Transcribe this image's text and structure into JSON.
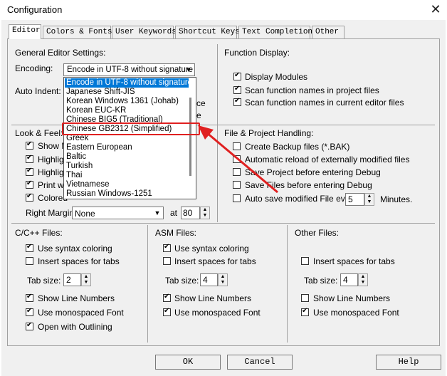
{
  "window": {
    "title": "Configuration",
    "close": "✕"
  },
  "tabs": [
    {
      "label": "Editor"
    },
    {
      "label": "Colors & Fonts"
    },
    {
      "label": "User Keywords"
    },
    {
      "label": "Shortcut Keys"
    },
    {
      "label": "Text Completion"
    },
    {
      "label": "Other"
    }
  ],
  "general": {
    "title": "General Editor Settings:",
    "encoding_label": "Encoding:",
    "encoding_value": "Encode in UTF-8 without signature",
    "auto_indent_label": "Auto Indent:",
    "partial_ce": "ce",
    "partial_e": "e"
  },
  "encoding_options": [
    "Encode in UTF-8 without signature",
    "Japanese Shift-JIS",
    "Korean Windows 1361 (Johab)",
    "Korean EUC-KR",
    "Chinese BIG5 (Traditional)",
    "Chinese GB2312 (Simplified)",
    "Greek",
    "Eastern European",
    "Baltic",
    "Turkish",
    "Thai",
    "Vietnamese",
    "Russian Windows-1251"
  ],
  "look_feel": {
    "title": "Look & Feel:",
    "items": [
      {
        "label": "Show M",
        "checked": true
      },
      {
        "label": "Highligh",
        "checked": true
      },
      {
        "label": "Highligh",
        "checked": true
      },
      {
        "label": "Print wit",
        "checked": true
      },
      {
        "label": "Colored",
        "checked": true
      }
    ],
    "right_margin_label": "Right Margin:",
    "right_margin_value": "None",
    "at_label": "at",
    "at_value": "80"
  },
  "function_display": {
    "title": "Function Display:",
    "items": [
      {
        "label": "Display Modules",
        "checked": true
      },
      {
        "label": "Scan function names in project files",
        "checked": true
      },
      {
        "label": "Scan function names in current editor files",
        "checked": true
      }
    ]
  },
  "file_project": {
    "title": "File & Project Handling:",
    "items": [
      {
        "label": "Create Backup files (*.BAK)",
        "checked": false
      },
      {
        "label": "Automatic reload of externally modified files",
        "checked": false
      },
      {
        "label": "Save Project before entering Debug",
        "checked": false
      },
      {
        "label": "Save Files before entering Debug",
        "checked": false
      }
    ],
    "autosave_label": "Auto save modified File every",
    "autosave_value": "5",
    "minutes_label": "Minutes."
  },
  "cpp": {
    "title": "C/C++ Files:",
    "syntax": "Use syntax coloring",
    "spaces": "Insert spaces for tabs",
    "tabsize_label": "Tab size:",
    "tabsize_value": "2",
    "line_numbers": "Show Line Numbers",
    "monospaced": "Use monospaced Font",
    "outlining": "Open with Outlining"
  },
  "asm": {
    "title": "ASM Files:",
    "syntax": "Use syntax coloring",
    "spaces": "Insert spaces for tabs",
    "tabsize_label": "Tab size:",
    "tabsize_value": "4",
    "line_numbers": "Show Line Numbers",
    "monospaced": "Use monospaced Font"
  },
  "other": {
    "title": "Other Files:",
    "spaces": "Insert spaces for tabs",
    "tabsize_label": "Tab size:",
    "tabsize_value": "4",
    "line_numbers": "Show Line Numbers",
    "monospaced": "Use monospaced Font"
  },
  "buttons": {
    "ok": "OK",
    "cancel": "Cancel",
    "help": "Help"
  },
  "colors": {
    "accent": "#0078d7",
    "highlight": "#e02020"
  }
}
